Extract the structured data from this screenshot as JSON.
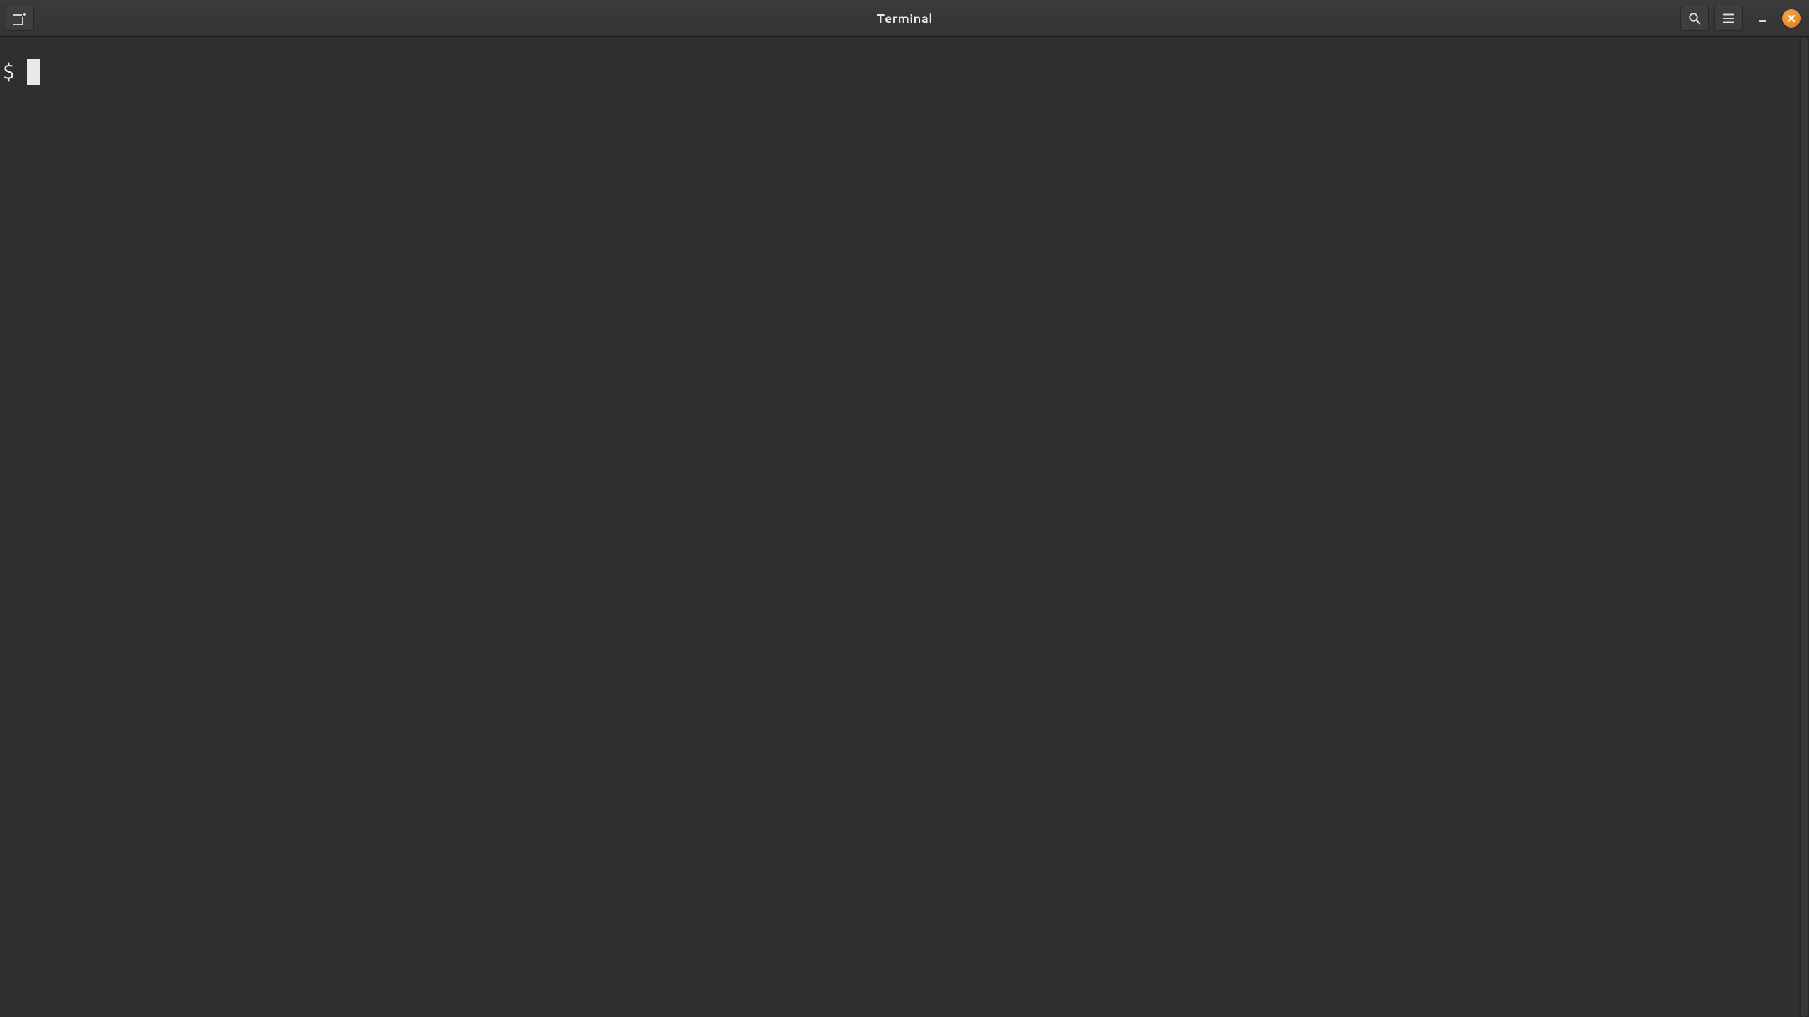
{
  "window": {
    "title": "Terminal"
  },
  "titlebar": {
    "new_tab_icon": "new-tab",
    "search_icon": "search",
    "menu_icon": "hamburger",
    "minimize_icon": "minimize",
    "close_icon": "close"
  },
  "terminal": {
    "prompt": "$ ",
    "input": ""
  },
  "colors": {
    "accent_close": "#e68a2e",
    "bg": "#2f2f2f",
    "fg": "#e8e8e8",
    "titlebar_bg": "#383838"
  }
}
